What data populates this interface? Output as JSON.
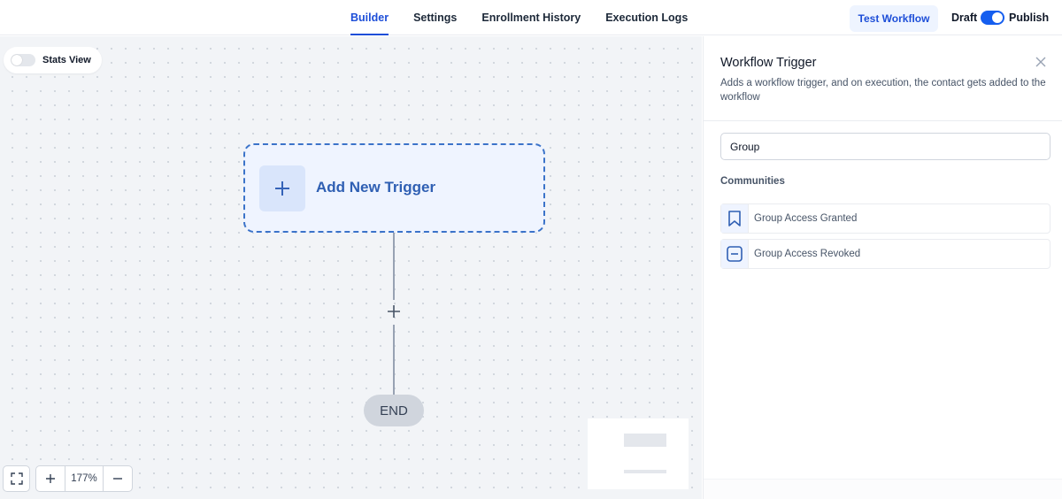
{
  "tabs": [
    {
      "label": "Builder",
      "active": true
    },
    {
      "label": "Settings",
      "active": false
    },
    {
      "label": "Enrollment History",
      "active": false
    },
    {
      "label": "Execution Logs",
      "active": false
    }
  ],
  "actions": {
    "test_workflow": "Test Workflow",
    "draft_label": "Draft",
    "publish_label": "Publish",
    "publish_on": true
  },
  "canvas": {
    "stats_view_label": "Stats View",
    "stats_view_on": false,
    "trigger_label": "Add New Trigger",
    "end_label": "END",
    "zoom_level": "177%"
  },
  "panel": {
    "title": "Workflow Trigger",
    "description": "Adds a workflow trigger, and on execution, the contact gets added to the workflow",
    "search_value": "Group",
    "section_label": "Communities",
    "options": [
      {
        "label": "Group Access Granted",
        "icon": "bookmark-icon"
      },
      {
        "label": "Group Access Revoked",
        "icon": "minus-square-icon"
      }
    ]
  },
  "colors": {
    "accent": "#1d4ed8",
    "toggle_on": "#155eef",
    "trigger_border": "#3b73c9",
    "canvas_bg": "#f2f4f7"
  }
}
